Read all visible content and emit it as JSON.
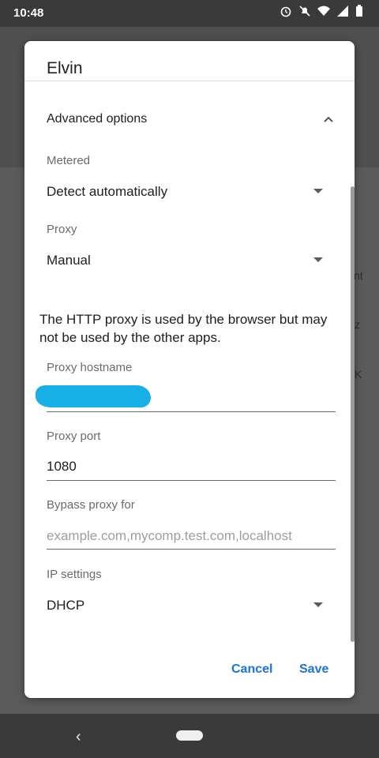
{
  "status_bar": {
    "time": "10:48"
  },
  "background": {
    "fragments": [
      "nt",
      "z",
      "K"
    ]
  },
  "dialog": {
    "title": "Elvin",
    "advanced_options": "Advanced options",
    "metered": {
      "label": "Metered",
      "value": "Detect automatically"
    },
    "proxy": {
      "label": "Proxy",
      "value": "Manual"
    },
    "info_text": "The HTTP proxy is used by the browser but may not be used by the other apps.",
    "proxy_hostname": {
      "label": "Proxy hostname",
      "value": ""
    },
    "proxy_port": {
      "label": "Proxy port",
      "value": "1080"
    },
    "bypass_proxy": {
      "label": "Bypass proxy for",
      "placeholder": "example.com,mycomp.test.com,localhost"
    },
    "ip_settings": {
      "label": "IP settings",
      "value": "DHCP"
    },
    "buttons": {
      "cancel": "Cancel",
      "save": "Save"
    }
  },
  "colors": {
    "accent": "#1a73e8",
    "redaction": "#17b0e6"
  }
}
